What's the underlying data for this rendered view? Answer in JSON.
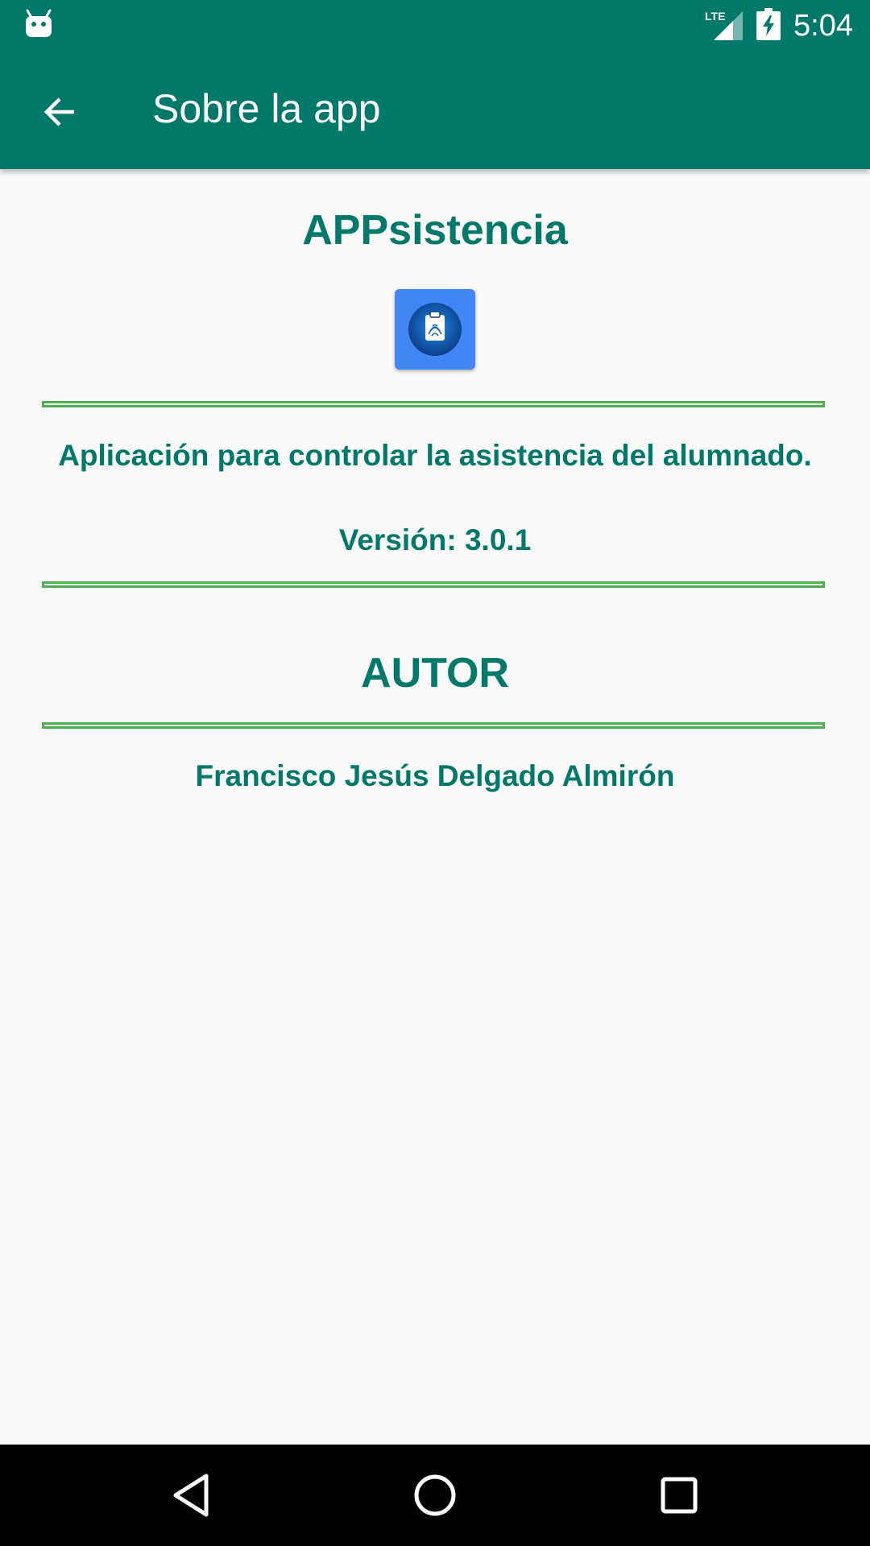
{
  "status_bar": {
    "time": "5:04",
    "network": "LTE"
  },
  "app_bar": {
    "title": "Sobre la app",
    "back_icon": "arrow-back-icon"
  },
  "about": {
    "app_name": "APPsistencia",
    "logo_icon": "clipboard-fingerprint-icon",
    "description": "Aplicación para controlar la asistencia del alumnado.",
    "version": "Versión: 3.0.1",
    "author_heading": "AUTOR",
    "author_name": "Francisco Jesús Delgado Almirón"
  },
  "nav_bar": {
    "back_icon": "nav-back-icon",
    "home_icon": "nav-home-icon",
    "recents_icon": "nav-recents-icon"
  },
  "colors": {
    "primary": "#00796b",
    "text_accent": "#00796b",
    "divider": "#4caf50",
    "background": "#fafafa",
    "logo_bg": "#4285f4"
  }
}
